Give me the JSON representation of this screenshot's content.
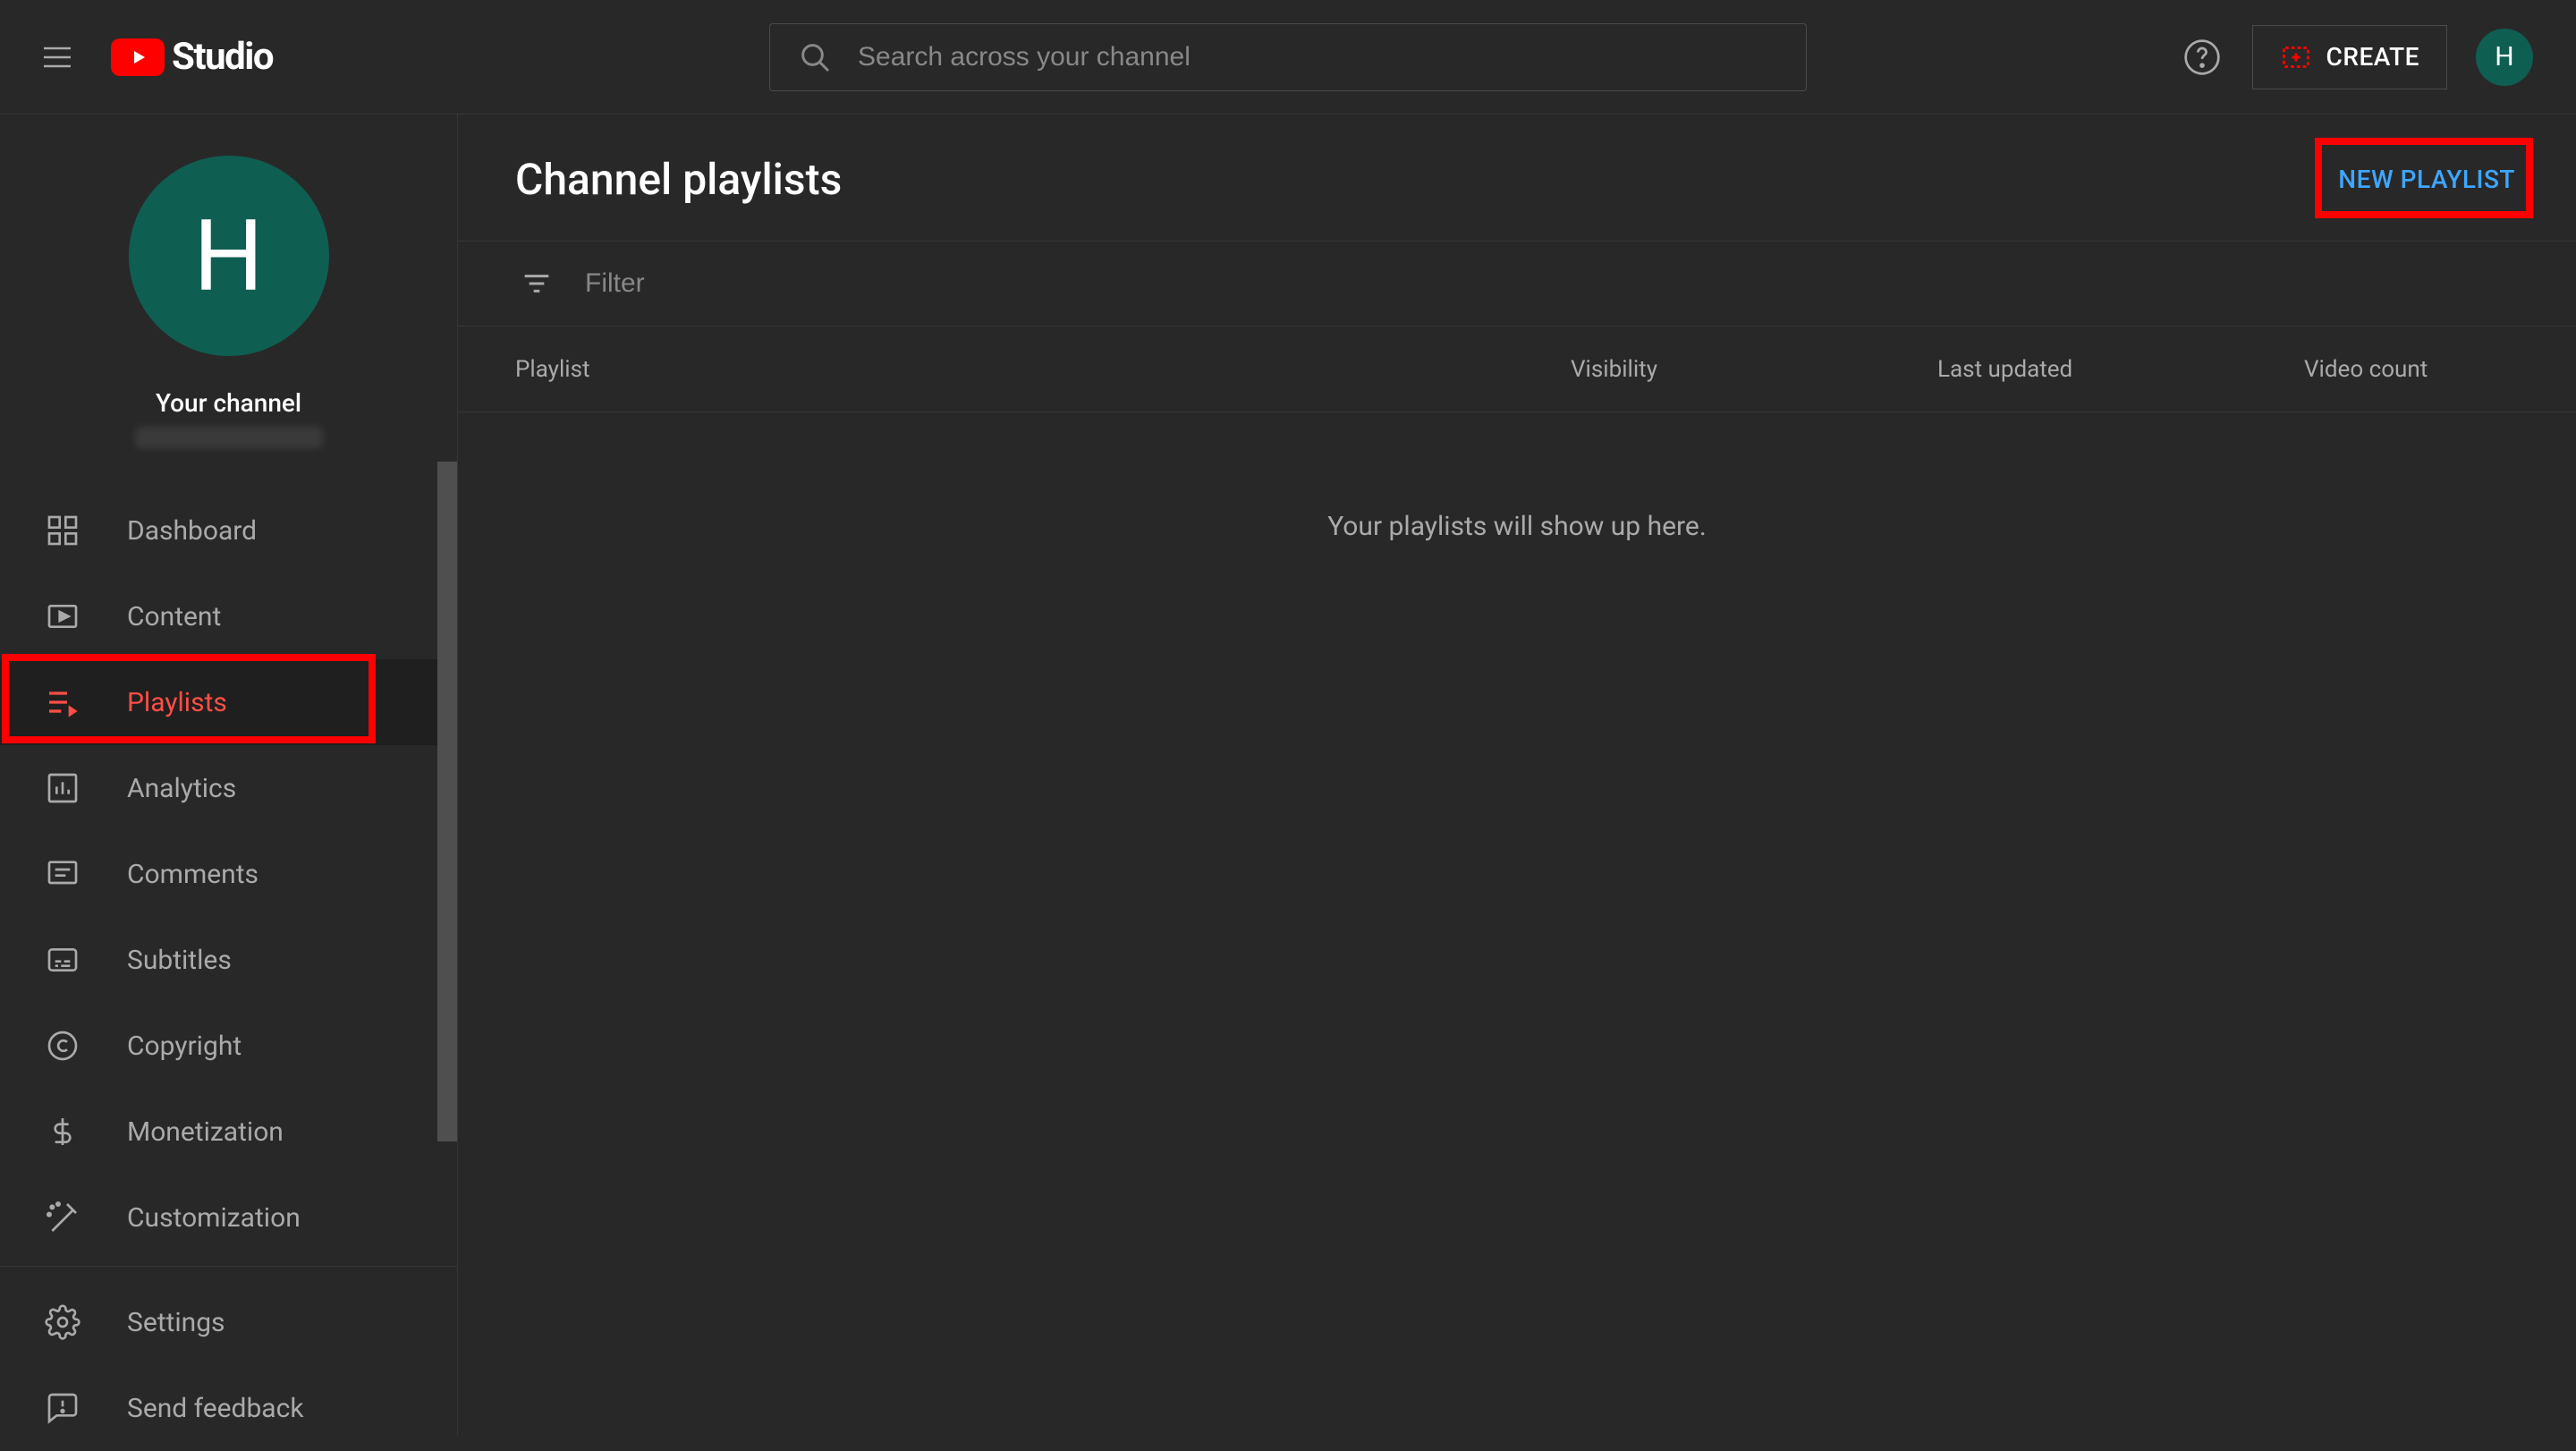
{
  "header": {
    "logo_text": "Studio",
    "search_placeholder": "Search across your channel",
    "create_label": "CREATE",
    "avatar_letter": "H"
  },
  "sidebar": {
    "channel_avatar_letter": "H",
    "channel_label": "Your channel",
    "items": [
      {
        "label": "Dashboard"
      },
      {
        "label": "Content"
      },
      {
        "label": "Playlists"
      },
      {
        "label": "Analytics"
      },
      {
        "label": "Comments"
      },
      {
        "label": "Subtitles"
      },
      {
        "label": "Copyright"
      },
      {
        "label": "Monetization"
      },
      {
        "label": "Customization"
      }
    ],
    "footer": [
      {
        "label": "Settings"
      },
      {
        "label": "Send feedback"
      }
    ]
  },
  "main": {
    "page_title": "Channel playlists",
    "new_playlist_label": "NEW PLAYLIST",
    "filter_placeholder": "Filter",
    "columns": {
      "playlist": "Playlist",
      "visibility": "Visibility",
      "updated": "Last updated",
      "count": "Video count"
    },
    "empty_message": "Your playlists will show up here."
  }
}
